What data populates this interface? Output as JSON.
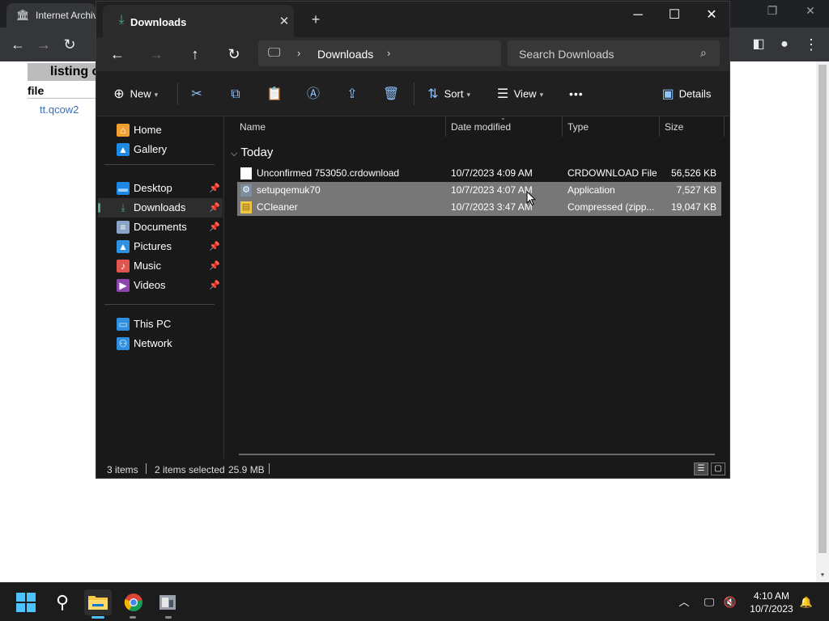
{
  "browser": {
    "tab_title": "Internet Archive",
    "page": {
      "listing_header": "listing of",
      "column_file": "file",
      "link": "tt.qcow2"
    }
  },
  "explorer": {
    "tab_title": "Downloads",
    "breadcrumb": "Downloads",
    "search_placeholder": "Search Downloads",
    "commands": {
      "new": "New",
      "sort": "Sort",
      "view": "View",
      "more": "•••",
      "details": "Details"
    },
    "nav_items": [
      {
        "label": "Home",
        "icon": "home-icon"
      },
      {
        "label": "Gallery",
        "icon": "gallery-icon"
      },
      {
        "label": "Desktop",
        "icon": "desktop-icon",
        "pinned": true
      },
      {
        "label": "Downloads",
        "icon": "download-icon",
        "pinned": true,
        "selected": true
      },
      {
        "label": "Documents",
        "icon": "documents-icon",
        "pinned": true
      },
      {
        "label": "Pictures",
        "icon": "pictures-icon",
        "pinned": true
      },
      {
        "label": "Music",
        "icon": "music-icon",
        "pinned": true
      },
      {
        "label": "Videos",
        "icon": "videos-icon",
        "pinned": true
      },
      {
        "label": "This PC",
        "icon": "this-pc-icon"
      },
      {
        "label": "Network",
        "icon": "network-icon"
      }
    ],
    "columns": [
      "Name",
      "Date modified",
      "Type",
      "Size"
    ],
    "group": "Today",
    "files": [
      {
        "name": "Unconfirmed 753050.crdownload",
        "date": "10/7/2023 4:09 AM",
        "type": "CRDOWNLOAD File",
        "size": "56,526 KB",
        "selected": false,
        "icon": "blank-file-icon"
      },
      {
        "name": "setupqemuk70",
        "date": "10/7/2023 4:07 AM",
        "type": "Application",
        "size": "7,527 KB",
        "selected": true,
        "icon": "installer-icon"
      },
      {
        "name": "CCleaner",
        "date": "10/7/2023 3:47 AM",
        "type": "Compressed (zipp...",
        "size": "19,047 KB",
        "selected": true,
        "icon": "zip-folder-icon"
      }
    ],
    "status": {
      "items": "3 items",
      "selected": "2 items selected",
      "size": "25.9 MB"
    }
  },
  "taskbar": {
    "time": "4:10 AM",
    "date": "10/7/2023",
    "apps": [
      "start-icon",
      "search-icon",
      "file-explorer-icon",
      "chrome-icon",
      "installer-app-icon"
    ]
  },
  "colors": {
    "accent_green": "#4caf7d",
    "selection": "#777777",
    "windows_blue": "#0078d4"
  }
}
